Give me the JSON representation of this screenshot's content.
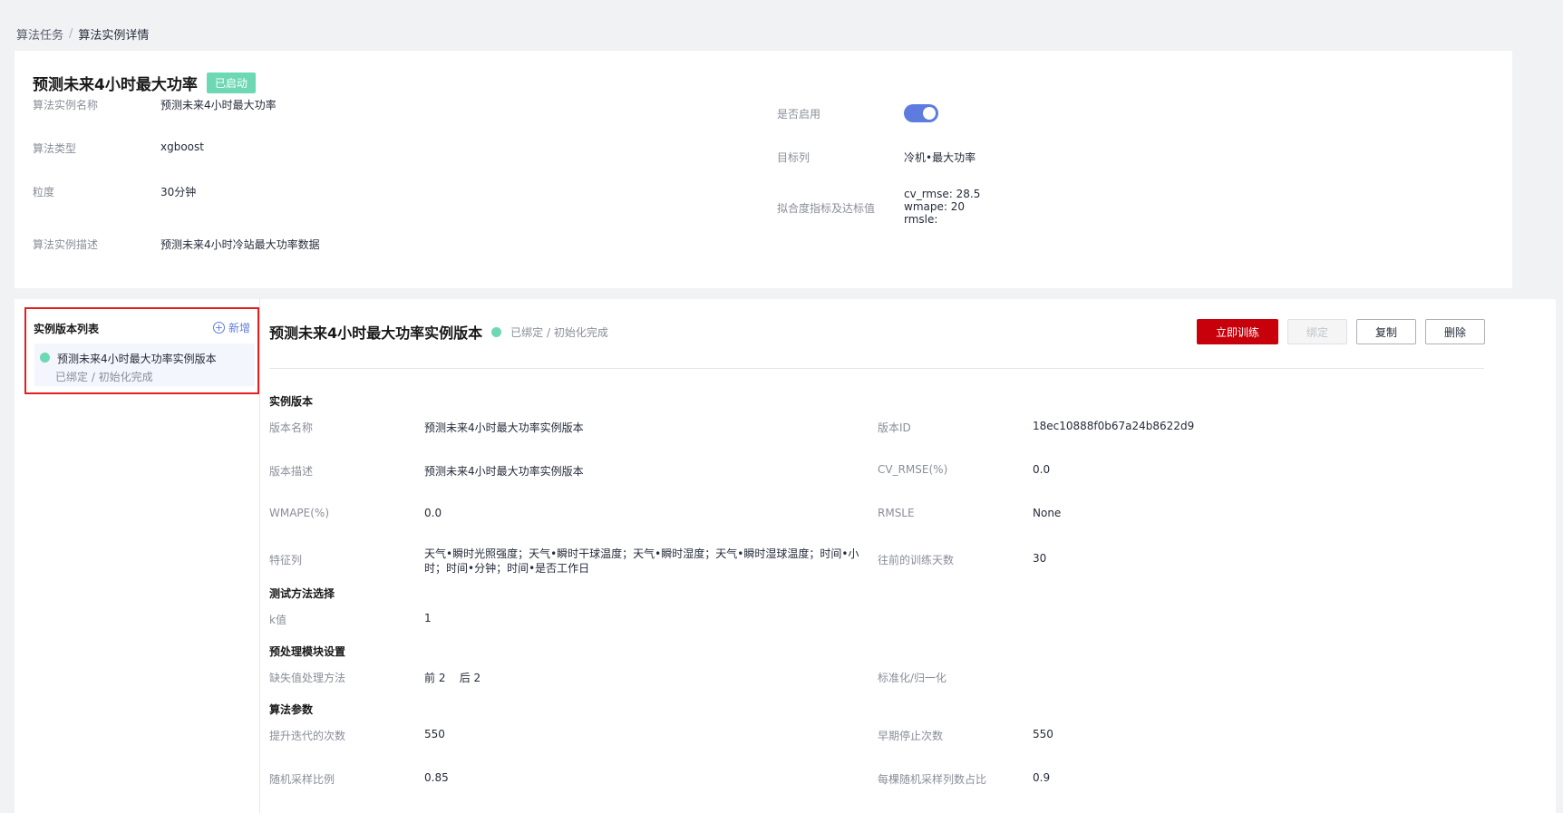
{
  "breadcrumb": {
    "parent": "算法任务",
    "separator": "/",
    "current": "算法实例详情"
  },
  "instance": {
    "title": "预测未来4小时最大功率",
    "status_tag": "已启动",
    "fields": {
      "name_label": "算法实例名称",
      "name_value": "预测未来4小时最大功率",
      "type_label": "算法类型",
      "type_value": "xgboost",
      "granularity_label": "粒度",
      "granularity_value": "30分钟",
      "desc_label": "算法实例描述",
      "desc_value": "预测未来4小时冷站最大功率数据",
      "enabled_label": "是否启用",
      "enabled": true,
      "target_label": "目标列",
      "target_value": "冷机•最大功率",
      "fit_label": "拟合度指标及达标值",
      "fit_lines": [
        "cv_rmse: 28.5",
        "wmape: 20",
        "rmsle:"
      ]
    }
  },
  "version_list": {
    "title": "实例版本列表",
    "add_label": "新增",
    "items": [
      {
        "name": "预测未来4小时最大功率实例版本",
        "status": "已绑定 / 初始化完成",
        "status_color": "#6dd8b4"
      }
    ]
  },
  "version_detail": {
    "title": "预测未来4小时最大功率实例版本",
    "status": "已绑定 / 初始化完成",
    "buttons": {
      "train": "立即训练",
      "bind": "绑定",
      "copy": "复制",
      "delete": "删除"
    },
    "sections": {
      "instance_version": "实例版本",
      "test_method": "测试方法选择",
      "preprocess": "预处理模块设置",
      "algo_params": "算法参数"
    },
    "fields": {
      "version_name_label": "版本名称",
      "version_name_value": "预测未来4小时最大功率实例版本",
      "version_id_label": "版本ID",
      "version_id_value": "18ec10888f0b67a24b8622d9",
      "version_desc_label": "版本描述",
      "version_desc_value": "预测未来4小时最大功率实例版本",
      "cv_rmse_label": "CV_RMSE(%)",
      "cv_rmse_value": "0.0",
      "wmape_label": "WMAPE(%)",
      "wmape_value": "0.0",
      "rmsle_label": "RMSLE",
      "rmsle_value": "None",
      "feature_label": "特征列",
      "feature_value": "天气•瞬时光照强度；天气•瞬时干球温度；天气•瞬时湿度；天气•瞬时湿球温度；时间•小时；时间•分钟；时间•是否工作日",
      "train_days_label": "往前的训练天数",
      "train_days_value": "30",
      "k_label": "k值",
      "k_value": "1",
      "missing_label": "缺失值处理方法",
      "missing_value": "前 2    后 2",
      "normalize_label": "标准化/归一化",
      "boost_iter_label": "提升迭代的次数",
      "boost_iter_value": "550",
      "early_stop_label": "早期停止次数",
      "early_stop_value": "550",
      "subsample_label": "随机采样比例",
      "subsample_value": "0.85",
      "colsample_label": "每棵随机采样列数占比",
      "colsample_value": "0.9"
    }
  },
  "colors": {
    "brand_red": "#c7000b",
    "accent_blue": "#5e7ce0",
    "success_green": "#6dd8b4",
    "highlight_border": "#e02020"
  }
}
